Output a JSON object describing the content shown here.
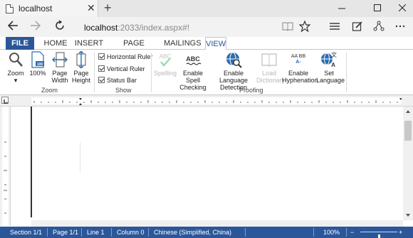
{
  "browser": {
    "tab_title": "localhost",
    "tab_close": "✕",
    "new_tab": "+",
    "url_host": "localhost",
    "url_path": ":2033/index.aspx#!"
  },
  "ribbon": {
    "tabs": [
      {
        "label": "FILE"
      },
      {
        "label": "HOME"
      },
      {
        "label": "INSERT"
      },
      {
        "label": "PAGE LAYOUT"
      },
      {
        "label": "MAILINGS"
      },
      {
        "label": "VIEW"
      }
    ],
    "active_tab": "VIEW",
    "zoom_group": {
      "label": "Zoom",
      "zoom": "Zoom",
      "zoom_100": "100%",
      "page_width": "Page Width",
      "page_height": "Page Height"
    },
    "show_group": {
      "label": "Show",
      "horizontal_ruler": "Horizontal Ruler",
      "vertical_ruler": "Vertical Ruler",
      "status_bar": "Status Bar"
    },
    "proofing_group": {
      "label": "Proofing",
      "spelling": "Spelling",
      "enable_spell_checking": "Enable Spell Checking",
      "enable_language_detection": "Enable Language Detection",
      "load_dictionary": "Load Dictionary",
      "enable_hyphenation": "Enable Hyphenation",
      "set_language": "Set Language"
    }
  },
  "status": {
    "section": "Section 1/1",
    "page": "Page 1/1",
    "line": "Line 1",
    "column": "Column 0",
    "language": "Chinese (Simplified, China)",
    "zoom": "100%",
    "zoom_minus": "−",
    "zoom_plus": "+",
    "zoom_level": 1.0
  },
  "colors": {
    "accent": "#2b579a"
  }
}
